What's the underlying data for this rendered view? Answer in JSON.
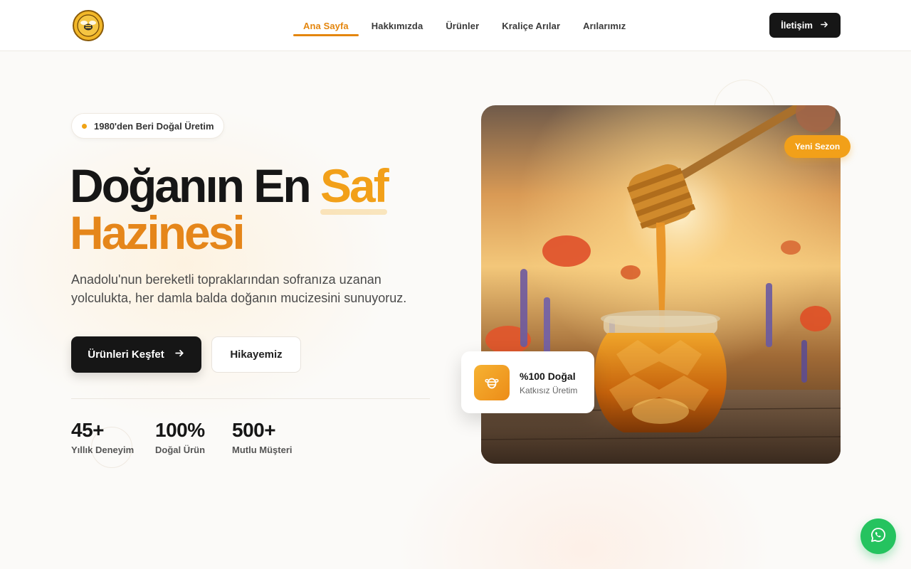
{
  "header": {
    "nav": [
      {
        "label": "Ana Sayfa",
        "active": true
      },
      {
        "label": "Hakkımızda",
        "active": false
      },
      {
        "label": "Ürünler",
        "active": false
      },
      {
        "label": "Kraliçe Arılar",
        "active": false
      },
      {
        "label": "Arılarımız",
        "active": false
      }
    ],
    "contact_label": "İletişim"
  },
  "hero": {
    "badge": "1980'den Beri Doğal Üretim",
    "title_part1": "Doğanın En ",
    "title_accent": "Saf",
    "title_part2": "Hazinesi",
    "description": "Anadolu'nun bereketli topraklarından sofranıza uzanan yolculukta, her damla balda doğanın mucizesini sunuyoruz.",
    "primary_button": "Ürünleri Keşfet",
    "secondary_button": "Hikayemiz",
    "stats": [
      {
        "value": "45+",
        "label": "Yıllık Deneyim"
      },
      {
        "value": "100%",
        "label": "Doğal Ürün"
      },
      {
        "value": "500+",
        "label": "Mutlu Müşteri"
      }
    ]
  },
  "image_card": {
    "season_badge": "Yeni Sezon",
    "natural_title": "%100 Doğal",
    "natural_sub": "Katkısız Üretim"
  },
  "colors": {
    "accent": "#f2a019",
    "dark": "#161616",
    "whatsapp": "#25c35f"
  },
  "icons": [
    "bee-logo-icon",
    "arrow-right-icon",
    "bee-icon",
    "whatsapp-icon"
  ]
}
